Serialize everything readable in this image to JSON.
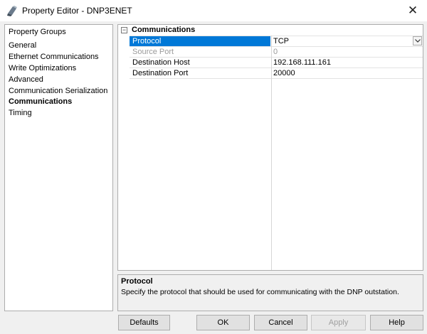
{
  "window": {
    "title": "Property Editor - DNP3ENET",
    "close_glyph": "✕"
  },
  "groups": {
    "header": "Property Groups",
    "items": [
      {
        "label": "General",
        "selected": false
      },
      {
        "label": "Ethernet Communications",
        "selected": false
      },
      {
        "label": "Write Optimizations",
        "selected": false
      },
      {
        "label": "Advanced",
        "selected": false
      },
      {
        "label": "Communication Serialization",
        "selected": false
      },
      {
        "label": "Communications",
        "selected": true
      },
      {
        "label": "Timing",
        "selected": false
      }
    ]
  },
  "grid": {
    "category": {
      "label": "Communications",
      "toggle": "−"
    },
    "properties": [
      {
        "name": "Protocol",
        "value": "TCP",
        "selected": true,
        "disabled": false,
        "dropdown": true
      },
      {
        "name": "Source Port",
        "value": "0",
        "selected": false,
        "disabled": true,
        "dropdown": false
      },
      {
        "name": "Destination Host",
        "value": "192.168.111.161",
        "selected": false,
        "disabled": false,
        "dropdown": false
      },
      {
        "name": "Destination Port",
        "value": "20000",
        "selected": false,
        "disabled": false,
        "dropdown": false
      }
    ]
  },
  "description": {
    "title": "Protocol",
    "text": "Specify the protocol that should be used for communicating with the DNP outstation."
  },
  "buttons": {
    "defaults": "Defaults",
    "ok": "OK",
    "cancel": "Cancel",
    "apply": "Apply",
    "help": "Help"
  },
  "colors": {
    "selection": "#0078d7",
    "disabled_text": "#9a9a9a"
  }
}
